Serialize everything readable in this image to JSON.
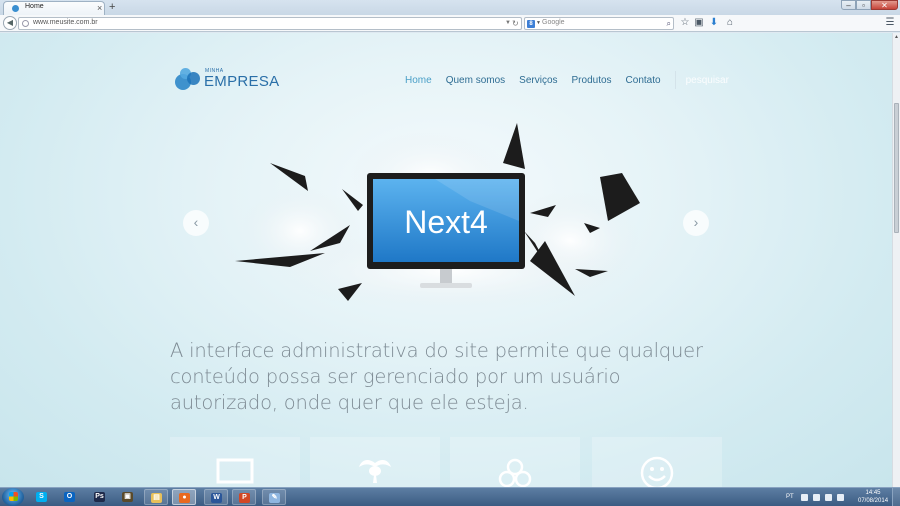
{
  "browser": {
    "tab": {
      "title": "Home",
      "close": "×"
    },
    "new_tab": "+",
    "window_buttons": {
      "minimize": "–",
      "maximize": "▫",
      "close": "✕"
    },
    "url": "www.meusite.com.br",
    "search_placeholder": "Google",
    "search_engine_letter": "8",
    "icons": [
      "back-icon",
      "reload-icon",
      "search-icon",
      "star-icon",
      "clipboard-icon",
      "download-icon",
      "home-icon",
      "menu-icon"
    ]
  },
  "site": {
    "logo": {
      "small": "MINHA",
      "big": "EMPRESA"
    },
    "nav": [
      {
        "label": "Home",
        "active": true
      },
      {
        "label": "Quem somos",
        "active": false
      },
      {
        "label": "Serviços",
        "active": false
      },
      {
        "label": "Produtos",
        "active": false
      },
      {
        "label": "Contato",
        "active": false
      }
    ],
    "search_label": "pesquisar",
    "hero": {
      "screen_text": "Next4",
      "prev": "‹",
      "next": "›"
    },
    "headline": "A interface administrativa do site permite que qualquer conteúdo possa ser gerenciado por um usuário autorizado, onde quer que ele esteja.",
    "feature_icons": [
      "monitor-icon",
      "palm-tree-icon",
      "cluster-icon",
      "smiley-icon"
    ]
  },
  "taskbar": {
    "apps": [
      {
        "name": "skype",
        "letter": "S",
        "color": "#00aff0"
      },
      {
        "name": "outlook",
        "letter": "O",
        "color": "#0a64c0"
      },
      {
        "name": "photoshop",
        "letter": "Ps",
        "color": "#1e2a4a"
      },
      {
        "name": "app",
        "letter": "▣",
        "color": "#5a4a2a"
      },
      {
        "name": "explorer",
        "letter": "▤",
        "color": "#e8c05a"
      },
      {
        "name": "firefox",
        "letter": "●",
        "color": "#e8691f"
      },
      {
        "name": "word",
        "letter": "W",
        "color": "#2a5699"
      },
      {
        "name": "powerpoint",
        "letter": "P",
        "color": "#d24726"
      },
      {
        "name": "paint",
        "letter": "✎",
        "color": "#8fb6e0"
      }
    ],
    "language": "PT",
    "time": "14:45",
    "date": "07/08/2014"
  }
}
